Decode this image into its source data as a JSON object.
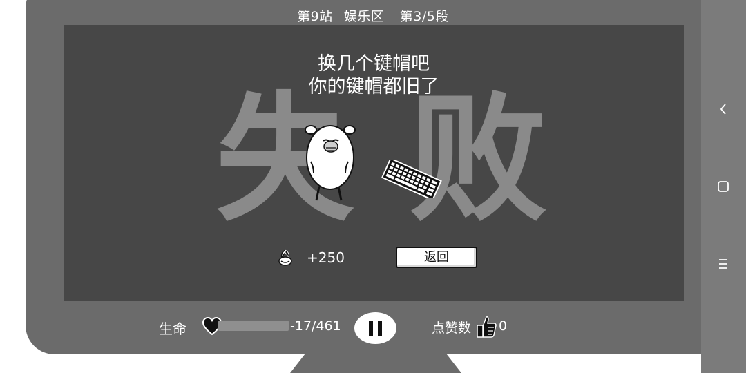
{
  "header": {
    "station": "第9站",
    "area": "娱乐区",
    "segment": "第3/5段"
  },
  "result": {
    "line1": "换几个键帽吧",
    "line2": "你的键帽都旧了",
    "big_char_1": "失",
    "big_char_2": "败"
  },
  "reward": {
    "icon": "seed-icon",
    "amount": "+250"
  },
  "back_button": {
    "label": "返回"
  },
  "hud": {
    "life_label": "生命",
    "life_value": "-17/461",
    "life_fraction": 0,
    "likes_label": "点赞数",
    "likes_count": "0"
  },
  "nav": {
    "back": "back-icon",
    "home": "home-icon",
    "menu": "menu-icon"
  }
}
